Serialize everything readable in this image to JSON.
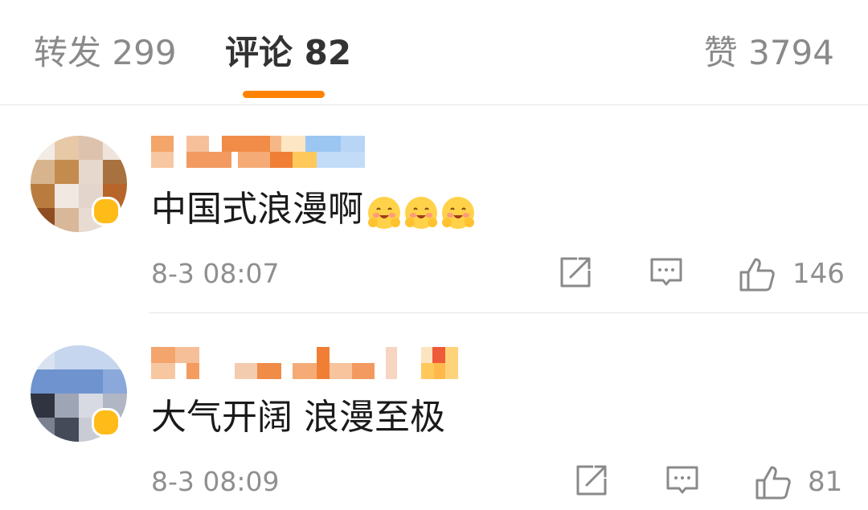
{
  "tabs": {
    "repost": {
      "label": "转发",
      "count": "299"
    },
    "comments": {
      "label": "评论",
      "count": "82",
      "active": true
    },
    "likes": {
      "label": "赞",
      "count": "3794"
    },
    "indicator_color": "#ff8200"
  },
  "comments": [
    {
      "username": "",
      "username_pixelated": true,
      "avatar_pixelated": true,
      "badge": "vip-badge",
      "text": "中国式浪漫啊",
      "emojis": [
        "hug-emoji",
        "hug-emoji",
        "hug-emoji"
      ],
      "timestamp": "8-3 08:07",
      "like_count": "146",
      "actions": [
        "repost-icon",
        "reply-icon",
        "like-icon"
      ]
    },
    {
      "username": "",
      "username_pixelated": true,
      "avatar_pixelated": true,
      "badge": "vip-badge",
      "text": "大气开阔 浪漫至极",
      "emojis": [],
      "timestamp": "8-3 08:09",
      "like_count": "81",
      "actions": [
        "repost-icon",
        "reply-icon",
        "like-icon"
      ]
    }
  ],
  "colors": {
    "accent": "#ff8200",
    "text_primary": "#1a1a1a",
    "text_secondary": "#8f8f8f",
    "divider": "#e6e6e6",
    "badge": "#ffbb18"
  }
}
